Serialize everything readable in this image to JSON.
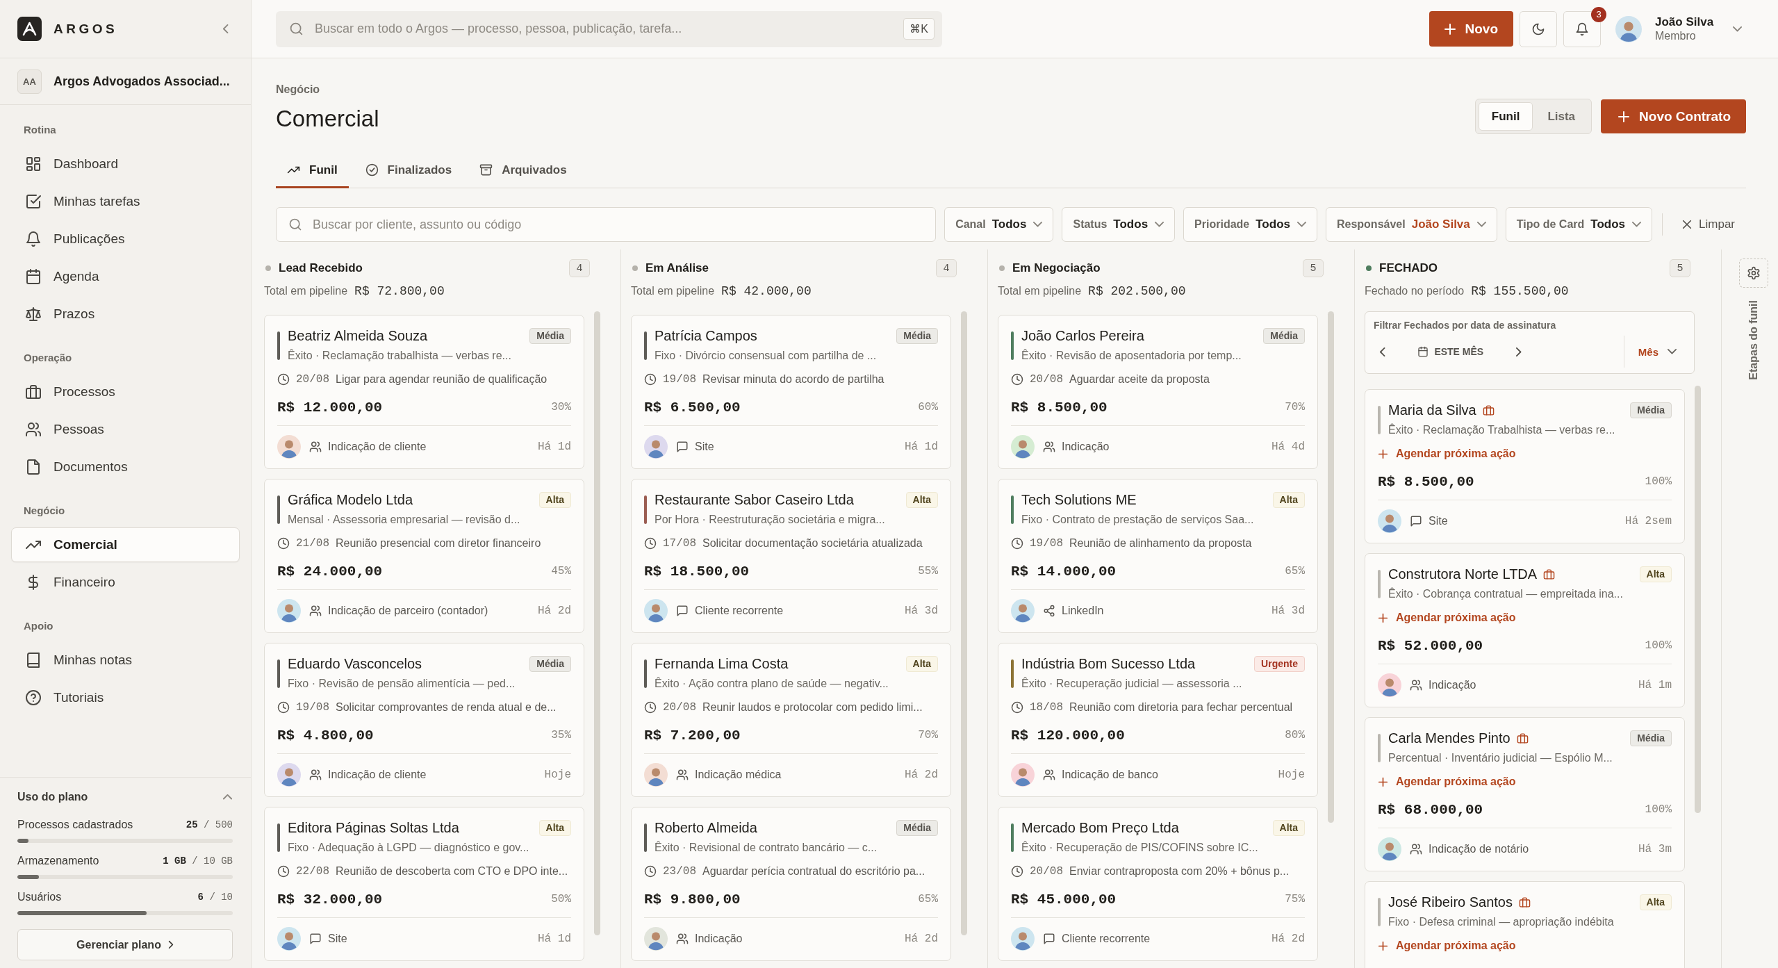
{
  "sidebar": {
    "brand": "ARGOS",
    "workspace": {
      "initials": "AA",
      "name": "Argos Advogados Associad..."
    },
    "sections": [
      {
        "label": "Rotina",
        "items": [
          {
            "label": "Dashboard",
            "selected": false
          },
          {
            "label": "Minhas tarefas",
            "selected": false
          },
          {
            "label": "Publicações",
            "selected": false
          },
          {
            "label": "Agenda",
            "selected": false
          },
          {
            "label": "Prazos",
            "selected": false
          }
        ]
      },
      {
        "label": "Operação",
        "items": [
          {
            "label": "Processos",
            "selected": false
          },
          {
            "label": "Pessoas",
            "selected": false
          },
          {
            "label": "Documentos",
            "selected": false
          }
        ]
      },
      {
        "label": "Negócio",
        "items": [
          {
            "label": "Comercial",
            "selected": true
          },
          {
            "label": "Financeiro",
            "selected": false
          }
        ]
      },
      {
        "label": "Apoio",
        "items": [
          {
            "label": "Minhas notas",
            "selected": false
          },
          {
            "label": "Tutoriais",
            "selected": false
          }
        ]
      }
    ],
    "plan_usage": {
      "title": "Uso do plano",
      "expanded": true,
      "meters": [
        {
          "label": "Processos cadastrados",
          "reading": "**25** / 500",
          "level": 0.05
        },
        {
          "label": "Armazenamento",
          "reading": "**1 GB** / 10 GB",
          "level": 0.1
        },
        {
          "label": "Usuários",
          "reading": "**6** / 10",
          "level": 0.6
        }
      ],
      "button": "Gerenciar plano"
    }
  },
  "top_bar": {
    "search": {
      "placeholder": "Buscar em todo o Argos — processo, pessoa, publicação, tarefa...",
      "shortcut": "⌘K"
    },
    "new_button": "Novo",
    "notifications": {
      "count": "3"
    },
    "user": {
      "name": "João Silva",
      "role": "Membro"
    }
  },
  "page": {
    "breadcrumb": "Negócio",
    "title": "Comercial",
    "view_toggle": [
      {
        "label": "Funil",
        "selected": true
      },
      {
        "label": "Lista",
        "selected": false
      }
    ],
    "primary_button": "Novo Contrato",
    "tabs": [
      {
        "label": "Funil",
        "selected": true
      },
      {
        "label": "Finalizados",
        "selected": false
      },
      {
        "label": "Arquivados",
        "selected": false
      }
    ],
    "filters": {
      "search": {
        "placeholder": "Buscar por cliente, assunto ou código"
      },
      "dropdowns": [
        {
          "label": "Canal",
          "value": "Todos",
          "active": false
        },
        {
          "label": "Status",
          "value": "Todos",
          "active": false
        },
        {
          "label": "Prioridade",
          "value": "Todos",
          "active": false
        },
        {
          "label": "Responsável",
          "value": "João Silva",
          "active": true
        },
        {
          "label": "Tipo de Card",
          "value": "Todos",
          "active": false
        }
      ],
      "clear_button": "Limpar"
    }
  },
  "board": {
    "columns": [
      {
        "title": "Lead Recebido",
        "color": "#b5b2ab",
        "count": "4",
        "total_label": "Total em pipeline",
        "total": "R$ 72.800,00",
        "cards": [
          {
            "name": "Beatriz Almeida Souza",
            "contract": false,
            "color": "#5e5c57",
            "priority": {
              "label": "Média",
              "kind": "medium"
            },
            "summary": "Êxito · Reclamação trabalhista — verbas re...",
            "next_action": {
              "date": "20/08",
              "text": "Ligar para agendar reunião de qualificação"
            },
            "amount": "R$ 12.000,00",
            "probability": "30%",
            "avatar": {
              "color": "#f3ddd3"
            },
            "source": {
              "label": "Indicação de cliente",
              "kind": "referral"
            },
            "age": "Há 1d"
          },
          {
            "name": "Gráfica Modelo Ltda",
            "contract": false,
            "color": "#5e5c57",
            "priority": {
              "label": "Alta",
              "kind": "high"
            },
            "summary": "Mensal · Assessoria empresarial — revisão d...",
            "next_action": {
              "date": "21/08",
              "text": "Reunião presencial com diretor financeiro"
            },
            "amount": "R$ 24.000,00",
            "probability": "45%",
            "avatar": {
              "color": "#cde5ef"
            },
            "source": {
              "label": "Indicação de parceiro (contador)",
              "kind": "referral"
            },
            "age": "Há 2d"
          },
          {
            "name": "Eduardo Vasconcelos",
            "contract": false,
            "color": "#5e5c57",
            "priority": {
              "label": "Média",
              "kind": "medium"
            },
            "summary": "Fixo · Revisão de pensão alimentícia — ped...",
            "next_action": {
              "date": "19/08",
              "text": "Solicitar comprovantes de renda atual e de..."
            },
            "amount": "R$ 4.800,00",
            "probability": "35%",
            "avatar": {
              "color": "#ddd9ee"
            },
            "source": {
              "label": "Indicação de cliente",
              "kind": "referral"
            },
            "age": "Hoje"
          },
          {
            "name": "Editora Páginas Soltas Ltda",
            "contract": false,
            "color": "#5e5c57",
            "priority": {
              "label": "Alta",
              "kind": "high"
            },
            "summary": "Fixo · Adequação à LGPD — diagnóstico e gov...",
            "next_action": {
              "date": "22/08",
              "text": "Reunião de descoberta com CTO e DPO inte..."
            },
            "amount": "R$ 32.000,00",
            "probability": "50%",
            "avatar": {
              "color": "#cde5ef"
            },
            "source": {
              "label": "Site",
              "kind": "web"
            },
            "age": "Há 1d"
          }
        ]
      },
      {
        "title": "Em Análise",
        "color": "#b5b2ab",
        "count": "4",
        "total_label": "Total em pipeline",
        "total": "R$ 42.000,00",
        "cards": [
          {
            "name": "Patrícia Campos",
            "contract": false,
            "color": "#5e5c57",
            "priority": {
              "label": "Média",
              "kind": "medium"
            },
            "summary": "Fixo · Divórcio consensual com partilha de ...",
            "next_action": {
              "date": "19/08",
              "text": "Revisar minuta do acordo de partilha"
            },
            "amount": "R$ 6.500,00",
            "probability": "60%",
            "avatar": {
              "color": "#ddd9ee"
            },
            "source": {
              "label": "Site",
              "kind": "web"
            },
            "age": "Há 1d"
          },
          {
            "name": "Restaurante Sabor Caseiro Ltda",
            "contract": false,
            "color": "#9b5d52",
            "priority": {
              "label": "Alta",
              "kind": "high"
            },
            "summary": "Por Hora · Reestruturação societária e migra...",
            "next_action": {
              "date": "17/08",
              "text": "Solicitar documentação societária atualizada"
            },
            "amount": "R$ 18.500,00",
            "probability": "55%",
            "avatar": {
              "color": "#cde5ef"
            },
            "source": {
              "label": "Cliente recorrente",
              "kind": "web"
            },
            "age": "Há 3d"
          },
          {
            "name": "Fernanda Lima Costa",
            "contract": false,
            "color": "#5e5c57",
            "priority": {
              "label": "Alta",
              "kind": "high"
            },
            "summary": "Êxito · Ação contra plano de saúde — negativ...",
            "next_action": {
              "date": "20/08",
              "text": "Reunir laudos e protocolar com pedido limi..."
            },
            "amount": "R$ 7.200,00",
            "probability": "70%",
            "avatar": {
              "color": "#f3ddd3"
            },
            "source": {
              "label": "Indicação médica",
              "kind": "referral"
            },
            "age": "Há 2d"
          },
          {
            "name": "Roberto Almeida",
            "contract": false,
            "color": "#5e5c57",
            "priority": {
              "label": "Média",
              "kind": "medium"
            },
            "summary": "Êxito · Revisional de contrato bancário — c...",
            "next_action": {
              "date": "23/08",
              "text": "Aguardar perícia contratual do escritório pa..."
            },
            "amount": "R$ 9.800,00",
            "probability": "65%",
            "avatar": {
              "color": "#e2e5dc"
            },
            "source": {
              "label": "Indicação",
              "kind": "referral"
            },
            "age": "Há 2d"
          }
        ]
      },
      {
        "title": "Em Negociação",
        "color": "#b5b2ab",
        "count": "5",
        "total_label": "Total em pipeline",
        "total": "R$ 202.500,00",
        "cards": [
          {
            "name": "João Carlos Pereira",
            "contract": false,
            "color": "#4f7d5e",
            "priority": {
              "label": "Média",
              "kind": "medium"
            },
            "summary": "Êxito · Revisão de aposentadoria por temp...",
            "next_action": {
              "date": "20/08",
              "text": "Aguardar aceite da proposta"
            },
            "amount": "R$ 8.500,00",
            "probability": "70%",
            "avatar": {
              "color": "#d5ecd2"
            },
            "source": {
              "label": "Indicação",
              "kind": "referral"
            },
            "age": "Há 4d"
          },
          {
            "name": "Tech Solutions ME",
            "contract": false,
            "color": "#4f7d5e",
            "priority": {
              "label": "Alta",
              "kind": "high"
            },
            "summary": "Fixo · Contrato de prestação de serviços Saa...",
            "next_action": {
              "date": "19/08",
              "text": "Reunião de alinhamento da proposta"
            },
            "amount": "R$ 14.000,00",
            "probability": "65%",
            "avatar": {
              "color": "#cde5ef"
            },
            "source": {
              "label": "LinkedIn",
              "kind": "social"
            },
            "age": "Há 3d"
          },
          {
            "name": "Indústria Bom Sucesso Ltda",
            "contract": false,
            "color": "#8c7335",
            "priority": {
              "label": "Urgente",
              "kind": "urgent"
            },
            "summary": "Êxito · Recuperação judicial — assessoria ...",
            "next_action": {
              "date": "18/08",
              "text": "Reunião com diretoria para fechar percentual"
            },
            "amount": "R$ 120.000,00",
            "probability": "80%",
            "avatar": {
              "color": "#f8d3d8"
            },
            "source": {
              "label": "Indicação de banco",
              "kind": "referral"
            },
            "age": "Hoje"
          },
          {
            "name": "Mercado Bom Preço Ltda",
            "contract": false,
            "color": "#4f7d5e",
            "priority": {
              "label": "Alta",
              "kind": "high"
            },
            "summary": "Êxito · Recuperação de PIS/COFINS sobre IC...",
            "next_action": {
              "date": "20/08",
              "text": "Enviar contraproposta com 20% + bônus p..."
            },
            "amount": "R$ 45.000,00",
            "probability": "75%",
            "avatar": {
              "color": "#cde5ef"
            },
            "source": {
              "label": "Cliente recorrente",
              "kind": "web"
            },
            "age": "Há 2d"
          }
        ]
      },
      {
        "title": "FECHADO",
        "color": "#4f7d5e",
        "count": "5",
        "total_label": "Fechado no período",
        "total": "R$ 155.500,00",
        "date_filter": {
          "label": "Filtrar Fechados por data de assinatura",
          "period": "ESTE MÊS",
          "granularity": "Mês"
        },
        "cards": [
          {
            "name": "Maria da Silva",
            "contract": true,
            "color": "#b9b6af",
            "priority": {
              "label": "Média",
              "kind": "medium"
            },
            "summary": "Êxito · Reclamação Trabalhista — verbas re...",
            "schedule_link": "Agendar próxima ação",
            "amount": "R$ 8.500,00",
            "probability": "100%",
            "avatar": {
              "color": "#cde5ef"
            },
            "source": {
              "label": "Site",
              "kind": "web"
            },
            "age": "Há 2sem"
          },
          {
            "name": "Construtora Norte LTDA",
            "contract": true,
            "color": "#b9b6af",
            "priority": {
              "label": "Alta",
              "kind": "high"
            },
            "summary": "Êxito · Cobrança contratual — empreitada ina...",
            "schedule_link": "Agendar próxima ação",
            "amount": "R$ 52.000,00",
            "probability": "100%",
            "avatar": {
              "color": "#f8d3d8"
            },
            "source": {
              "label": "Indicação",
              "kind": "referral"
            },
            "age": "Há 1m"
          },
          {
            "name": "Carla Mendes Pinto",
            "contract": true,
            "color": "#b9b6af",
            "priority": {
              "label": "Média",
              "kind": "medium"
            },
            "summary": "Percentual · Inventário judicial — Espólio M...",
            "schedule_link": "Agendar próxima ação",
            "amount": "R$ 68.000,00",
            "probability": "100%",
            "avatar": {
              "color": "#cde8e4"
            },
            "source": {
              "label": "Indicação de notário",
              "kind": "referral"
            },
            "age": "Há 3m"
          },
          {
            "name": "José Ribeiro Santos",
            "contract": true,
            "color": "#b9b6af",
            "priority": {
              "label": "Alta",
              "kind": "high"
            },
            "summary": "Fixo · Defesa criminal — apropriação indébita",
            "schedule_link": "Agendar próxima ação"
          }
        ]
      }
    ]
  },
  "side_rail": {
    "label": "Etapas do funil"
  }
}
